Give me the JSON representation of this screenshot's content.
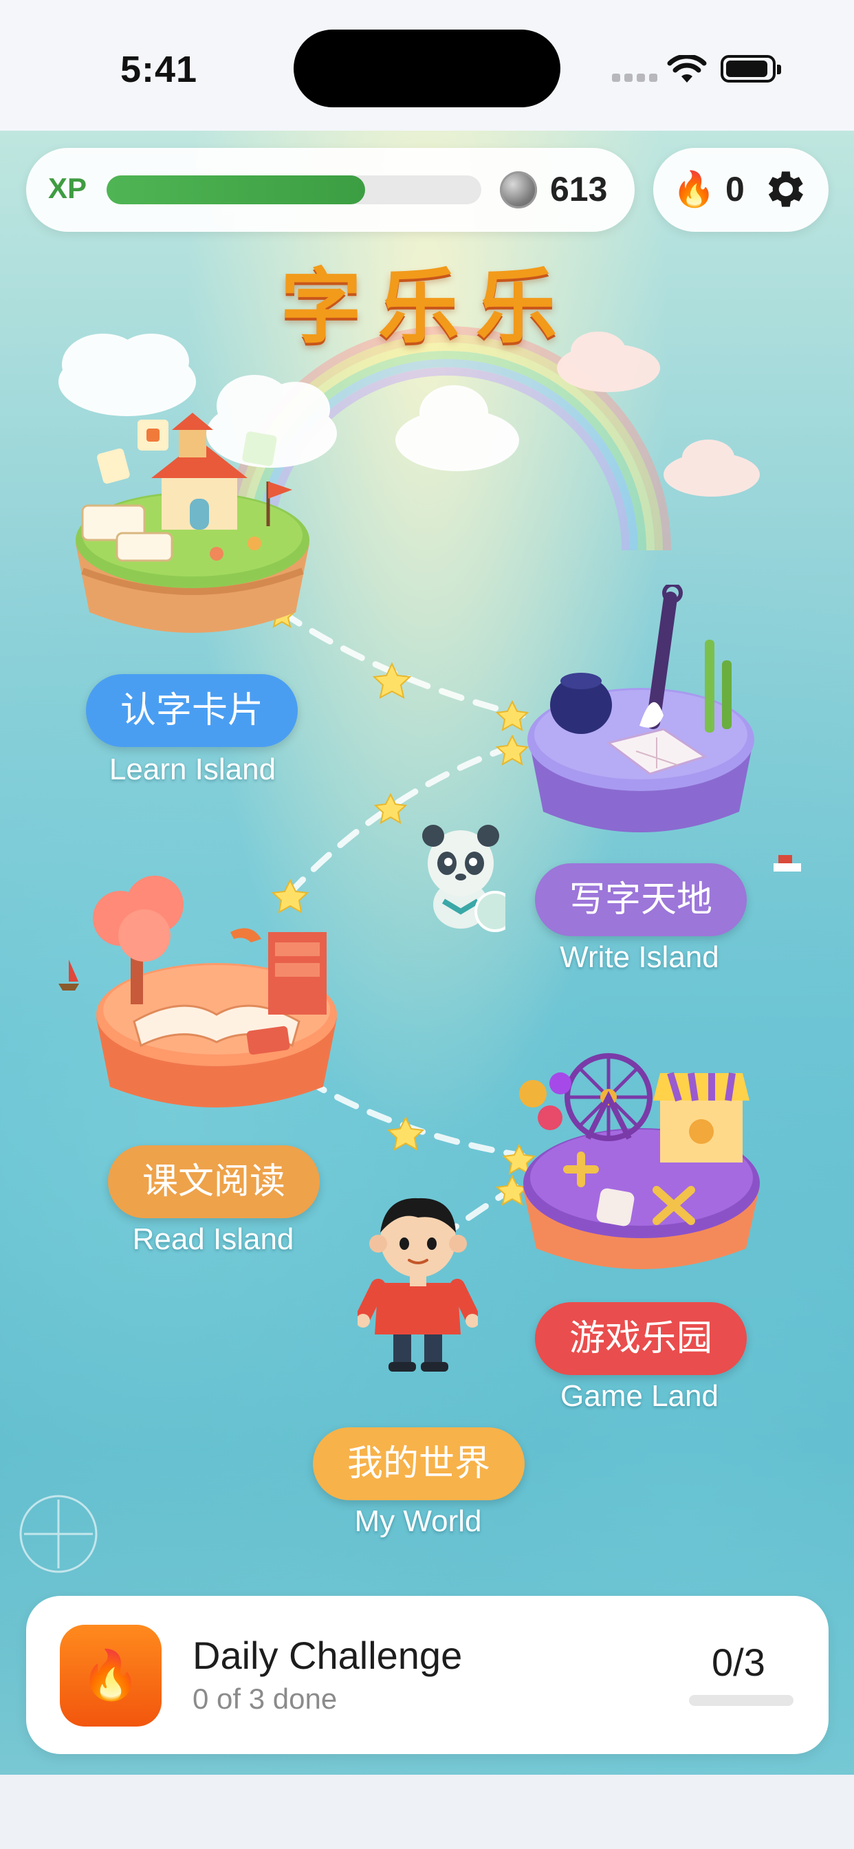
{
  "status_bar": {
    "time": "5:41"
  },
  "hud": {
    "xp_label": "XP",
    "xp_progress": 0.69,
    "coins": "613",
    "streak": "0"
  },
  "title": "字乐乐",
  "islands": [
    {
      "label_cn": "认字卡片",
      "label_en": "Learn Island",
      "color": "#4a9ef2"
    },
    {
      "label_cn": "写字天地",
      "label_en": "Write Island",
      "color": "#9c76d9"
    },
    {
      "label_cn": "课文阅读",
      "label_en": "Read Island",
      "color": "#eea24a"
    },
    {
      "label_cn": "游戏乐园",
      "label_en": "Game Land",
      "color": "#ea4d4d"
    },
    {
      "label_cn": "我的世界",
      "label_en": "My World",
      "color": "#f7b24a"
    }
  ],
  "daily": {
    "title": "Daily Challenge",
    "subtitle": "0 of 3 done",
    "count": "0/3",
    "progress": 0
  }
}
